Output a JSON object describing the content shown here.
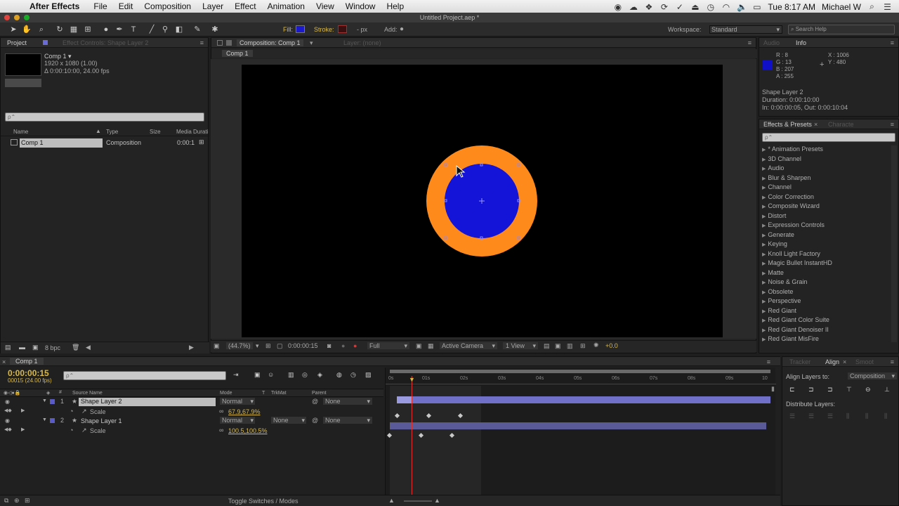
{
  "menubar": {
    "app": "After Effects",
    "items": [
      "File",
      "Edit",
      "Composition",
      "Layer",
      "Effect",
      "Animation",
      "View",
      "Window",
      "Help"
    ],
    "clock": "Tue 8:17 AM",
    "user": "Michael W"
  },
  "window": {
    "title": "Untitled Project.aep *"
  },
  "toolbar": {
    "fill_label": "Fill:",
    "stroke_label": "Stroke:",
    "stroke_width": "- px",
    "add_label": "Add:",
    "fill_color": "#1a1acc",
    "stroke_color": "#8a2020",
    "workspace_label": "Workspace:",
    "workspace_value": "Standard",
    "search_placeholder": "Search Help"
  },
  "project_panel": {
    "tab": "Project",
    "tab2": "Effect Controls: Shape Layer 2",
    "item_name": "Comp 1 ▾",
    "item_res": "1920 x 1080 (1.00)",
    "item_dur": "Δ 0:00:10:00, 24.00 fps",
    "search_placeholder": "ρ⌃",
    "columns": [
      "Name",
      "Type",
      "Size",
      "Media Durati"
    ],
    "row": {
      "name": "Comp 1",
      "type": "Composition",
      "duration": "0:00:1"
    },
    "footer_bpc": "8 bpc"
  },
  "comp_panel": {
    "tab": "Composition: Comp 1",
    "tab2": "Layer: (none)",
    "subtab": "Comp 1",
    "zoom": "(44.7%)",
    "timecode": "0:00:00:15",
    "resolution": "Full",
    "camera": "Active Camera",
    "views": "1 View",
    "exposure": "+0.0"
  },
  "info_panel": {
    "tab": "Audio",
    "tab2": "Info",
    "r": "R : 8",
    "g": "G : 13",
    "b": "B : 207",
    "a": "A : 255",
    "x": "X : 1006",
    "y": "Y : 480",
    "swatch_color": "#1010c8",
    "layer_name": "Shape Layer 2",
    "duration": "Duration: 0:00:10:00",
    "inout": "In: 0:00:00:05, Out: 0:00:10:04"
  },
  "effects_panel": {
    "tab": "Effects & Presets",
    "tab2": "Characte",
    "search_placeholder": "ρ⌃",
    "items": [
      "* Animation Presets",
      "3D Channel",
      "Audio",
      "Blur & Sharpen",
      "Channel",
      "Color Correction",
      "Composite Wizard",
      "Distort",
      "Expression Controls",
      "Generate",
      "Keying",
      "Knoll Light Factory",
      "Magic Bullet InstantHD",
      "Matte",
      "Noise & Grain",
      "Obsolete",
      "Perspective",
      "Red Giant",
      "Red Giant Color Suite",
      "Red Giant Denoiser II",
      "Red Giant MisFire"
    ]
  },
  "align_panel": {
    "tab": "Tracker",
    "tab2": "Align",
    "tab3": "Smoot",
    "align_label": "Align Layers to:",
    "align_value": "Composition",
    "distribute_label": "Distribute Layers:"
  },
  "timeline": {
    "tab": "Comp 1",
    "timecode": "0:00:00:15",
    "frames": "00015 (24.00 fps)",
    "search_placeholder": "ρ⌃",
    "col_source": "Source Name",
    "col_mode": "Mode",
    "col_t": "T",
    "col_trkmat": "TrkMat",
    "col_parent": "Parent",
    "ruler": [
      "0s",
      "01s",
      "02s",
      "03s",
      "04s",
      "05s",
      "06s",
      "07s",
      "08s",
      "09s",
      "10"
    ],
    "layers": [
      {
        "num": "1",
        "name": "Shape Layer 2",
        "mode": "Normal",
        "trkmat": "",
        "parent": "None",
        "prop": "Scale",
        "value": "67.9,67.9%"
      },
      {
        "num": "2",
        "name": "Shape Layer 1",
        "mode": "Normal",
        "trkmat": "None",
        "parent": "None",
        "prop": "Scale",
        "value": "100.5,100.5%"
      }
    ],
    "footer": "Toggle Switches / Modes"
  },
  "colors": {
    "outer_circle": "#ff8a1c",
    "inner_circle": "#1414d8",
    "layer1_label": "#5a5ac8",
    "layer_bar": "#7070c8"
  }
}
